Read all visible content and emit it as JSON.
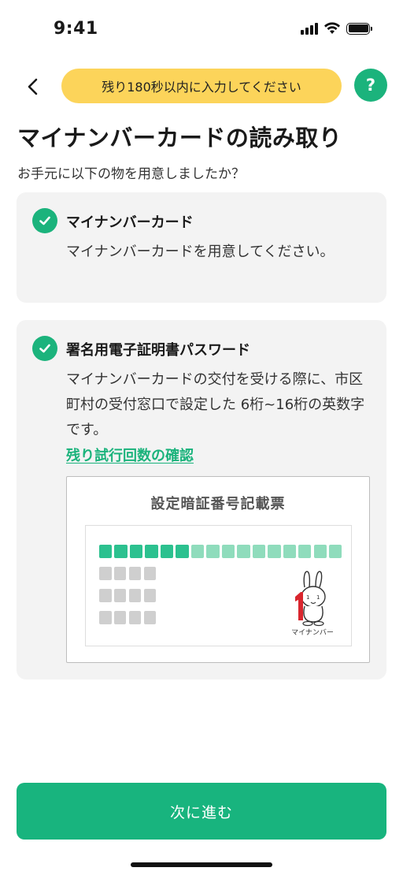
{
  "status_bar": {
    "time": "9:41"
  },
  "header": {
    "back_icon": "chevron-left-icon",
    "timer_text": "残り180秒以内に入力してください",
    "help_label": "?"
  },
  "page": {
    "title": "マイナンバーカードの読み取り",
    "subtitle": "お手元に以下の物を用意しましたか？"
  },
  "cards": [
    {
      "title": "マイナンバーカード",
      "body": "マイナンバーカードを用意してください。"
    },
    {
      "title": "署名用電子証明書パスワード",
      "body": "マイナンバーカードの交付を受ける際に、市区町村の受付窓口で設定した 6桁~16桁の英数字です。",
      "link": "残り試行回数の確認",
      "ticket": {
        "title": "設定暗証番号記載票",
        "digit_count": 16,
        "highlighted_digits": 6,
        "pin_rows": 3,
        "pin_cols": 4,
        "mascot_label": "マイナンバー"
      }
    }
  ],
  "footer": {
    "next_button": "次に進む"
  },
  "colors": {
    "accent": "#1bb37c",
    "timer_bg": "#fcd45a",
    "card_bg": "#f3f3f3"
  }
}
